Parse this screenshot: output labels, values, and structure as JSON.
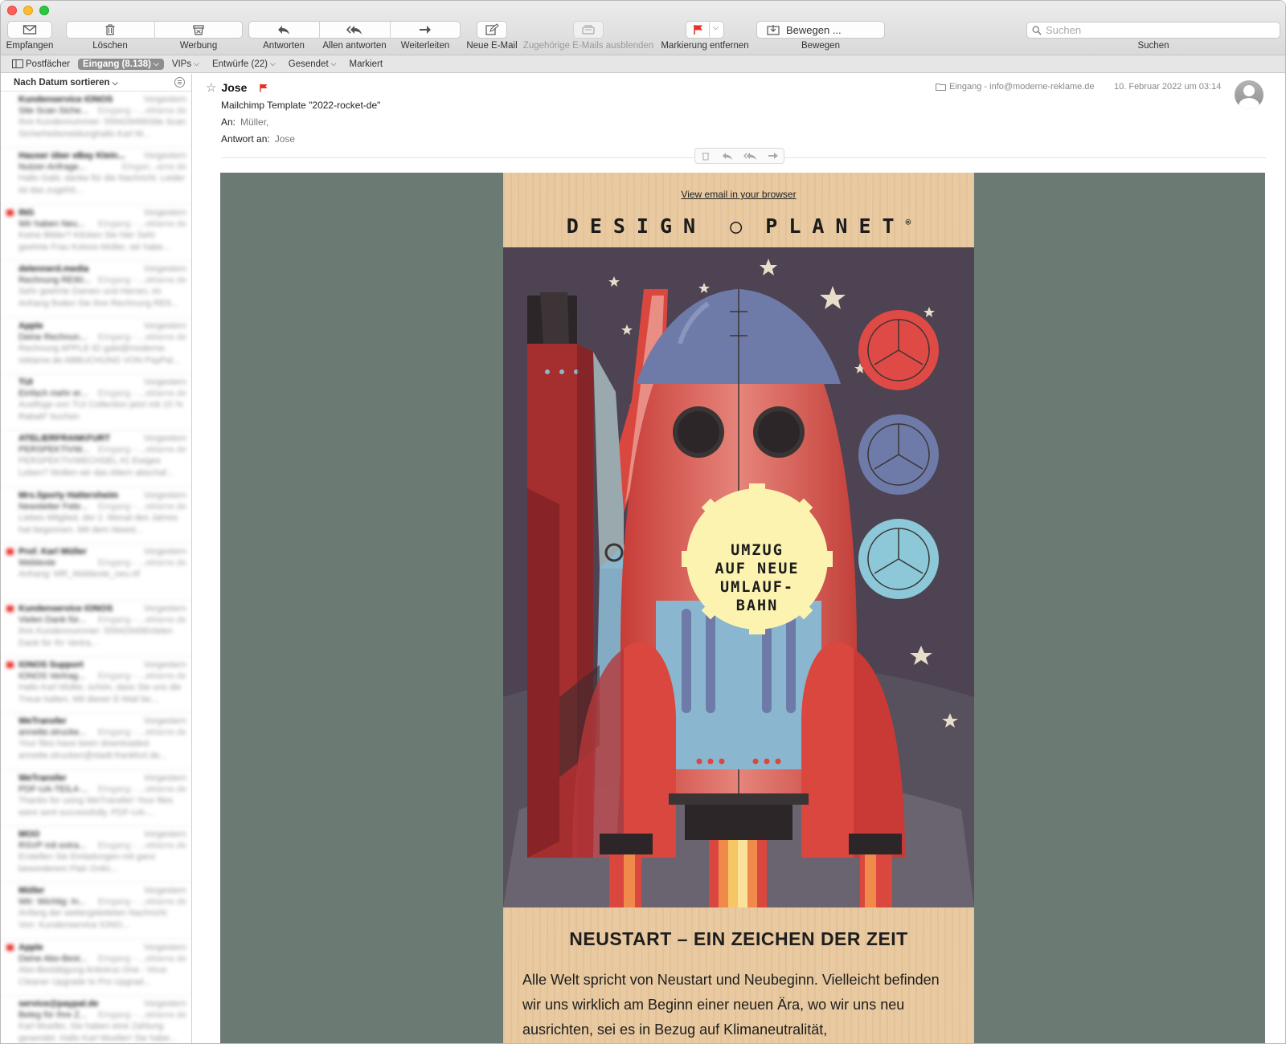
{
  "toolbar": {
    "get_mail": "Empfangen",
    "delete": "Löschen",
    "junk": "Werbung",
    "reply": "Antworten",
    "reply_all": "Allen antworten",
    "forward": "Weiterleiten",
    "new_mail": "Neue E-Mail",
    "hide_related": "Zugehörige E-Mails ausblenden",
    "unflag": "Markierung entfernen",
    "move_button": "Bewegen ...",
    "move": "Bewegen",
    "search_placeholder": "Suchen",
    "search": "Suchen"
  },
  "favorites": {
    "mailboxes": "Postfächer",
    "inbox": "Eingang (8.138)",
    "vips": "VIPs",
    "drafts": "Entwürfe (22)",
    "sent": "Gesendet",
    "flagged": "Markiert"
  },
  "message_list": {
    "sort_label": "Nach Datum sortieren",
    "messages": [
      {
        "sender": "Kundenservice IONOS",
        "when": "Vorgestern",
        "subject": "Site Scan Siche...",
        "mailbox": "Eingang - ...eklame.de",
        "preview": "Ihre Kundennummer: 559429496Site Scan Sicherheitsmeldunghallo Karl M...",
        "flagged": false
      },
      {
        "sender": "Hauser über eBay Klein...",
        "when": "Vorgestern",
        "subject": "Nutzer-Anfrage...",
        "mailbox": "Eingan...ame.de",
        "preview": "Hallo Gabi, danke für die Nachricht. Leider ist das zugehö...",
        "flagged": false
      },
      {
        "sender": "ING",
        "when": "Vorgestern",
        "subject": "Wir haben Neu...",
        "mailbox": "Eingang - ...eklame.de",
        "preview": "Keine Bilder? Klicken Sie hier Sehr geehrte Frau Koloss-Müller, wir habe...",
        "flagged": true
      },
      {
        "sender": "delennerd.media",
        "when": "Vorgestern",
        "subject": "Rechnung RE90...",
        "mailbox": "Eingang - ...eklame.de",
        "preview": "Sehr geehrte Damen und Herren, im Anhang finden Sie Ihre Rechnung RE9...",
        "flagged": false
      },
      {
        "sender": "Apple",
        "when": "Vorgestern",
        "subject": "Deine Rechnun...",
        "mailbox": "Eingang - ...eklame.de",
        "preview": "Rechnung APPLE-ID gabi@moderne-reklame.de ABBUCHUNG VON PayPal...",
        "flagged": false
      },
      {
        "sender": "TUI",
        "when": "Vorgestern",
        "subject": "Einfach mehr er...",
        "mailbox": "Eingang - ...eklame.de",
        "preview": "Ausflüge von TUI Collection jetzt mit 15 % Rabatt* buchen",
        "flagged": false
      },
      {
        "sender": "ATELIERFRANKFURT",
        "when": "Vorgestern",
        "subject": "PERSPEKTIVW...",
        "mailbox": "Eingang - ...eklame.de",
        "preview": "PERSPEKTIVWECHSEL #1 Ewiges Leben? Wollen wir das Altern abschaf...",
        "flagged": false
      },
      {
        "sender": "Mrs.Sporty Hattersheim",
        "when": "Vorgestern",
        "subject": "Newsletter Febr...",
        "mailbox": "Eingang - ...eklame.de",
        "preview": "Liebes Mitglied, der 2. Monat des Jahres hat begonnen. Mit dem Newsl...",
        "flagged": false
      },
      {
        "sender": "Prof. Karl Müller",
        "when": "Vorgestern",
        "subject": "Webtexte",
        "mailbox": "Eingang - ...eklame.de",
        "preview": "Anhang: MR_Webtexte_neu.rtf",
        "flagged": true
      },
      {
        "sender": "Kundenservice IONOS",
        "when": "Vorgestern",
        "subject": "Vielen Dank für...",
        "mailbox": "Eingang - ...eklame.de",
        "preview": "Ihre Kundennummer: 559429496Vielen Dank für Ihr Vertra...",
        "flagged": true
      },
      {
        "sender": "IONOS Support",
        "when": "Vorgestern",
        "subject": "IONOS Vertrag...",
        "mailbox": "Eingang - ...eklame.de",
        "preview": "Hallo Karl Müller, schön, dass Sie uns die Treue halten. Mit dieser E-Mail be...",
        "flagged": true
      },
      {
        "sender": "WeTransfer",
        "when": "Vorgestern",
        "subject": "annette.strucke...",
        "mailbox": "Eingang - ...eklame.de",
        "preview": "Your files have been downloaded. annette.strucken@stadt-frankfurt.de...",
        "flagged": false
      },
      {
        "sender": "WeTransfer",
        "when": "Vorgestern",
        "subject": "PDF-UA-TEIL4-...",
        "mailbox": "Eingang - ...eklame.de",
        "preview": "Thanks for using WeTransfer! Your files were sent successfully. PDF-UA-...",
        "flagged": false
      },
      {
        "sender": "MOO",
        "when": "Vorgestern",
        "subject": "RSVP mit extra...",
        "mailbox": "Eingang - ...eklame.de",
        "preview": "Erstellen Sie Einladungen mit ganz besonderem Flair Onlin...",
        "flagged": false
      },
      {
        "sender": "Müller",
        "when": "Vorgestern",
        "subject": "Wtr: Wichtig: In...",
        "mailbox": "Eingang - ...eklame.de",
        "preview": "Anfang der weitergeleiteten Nachricht: Von: Kundenservice IONO...",
        "flagged": false
      },
      {
        "sender": "Apple",
        "when": "Vorgestern",
        "subject": "Deine Abo-Best...",
        "mailbox": "Eingang - ...eklame.de",
        "preview": "Abo-Bestätigung Antivirus One - Virus Cleaner Upgrade to Pro Upgrad...",
        "flagged": true
      },
      {
        "sender": "service@paypal.de",
        "when": "Vorgestern",
        "subject": "Beleg für Ihre Z...",
        "mailbox": "Eingang - ...eklame.de",
        "preview": "Karl Mueller, Sie haben eine Zahlung gesendet. Hallo Karl Mueller! Sie habe...",
        "flagged": false
      }
    ]
  },
  "reader": {
    "from": "Jose",
    "subject": "Mailchimp Template \"2022-rocket-de\"",
    "to_label": "An:",
    "to_value": "Müller,",
    "reply_to_label": "Antwort an:",
    "reply_to_value": "Jose",
    "mailbox": "Eingang - info@moderne-reklame.de",
    "date": "10. Februar 2022 um 03:14"
  },
  "email": {
    "view_in_browser": "View email in your browser",
    "brand_left": "DESIGN",
    "brand_right": "PLANET",
    "brand_mark": "®",
    "badge_line1": "UMZUG",
    "badge_line2": "AUF NEUE",
    "badge_line3": "UMLAUF-",
    "badge_line4": "BAHN",
    "headline": "NEUSTART – EIN ZEICHEN DER ZEIT",
    "body": "Alle Welt spricht von Neustart und Neubeginn. Vielleicht befinden wir uns wirklich am Beginn einer neuen Ära, wo wir uns neu ausrichten, sei es in Bezug auf Klimaneutralität,"
  },
  "colors": {
    "email_background": "#6b7a73",
    "email_paper": "#e8c9a0",
    "flag_red": "#e8312b",
    "rocket_red": "#d9473f",
    "rocket_blue": "#8ab7cf",
    "badge_yellow": "#fdf3b0"
  }
}
